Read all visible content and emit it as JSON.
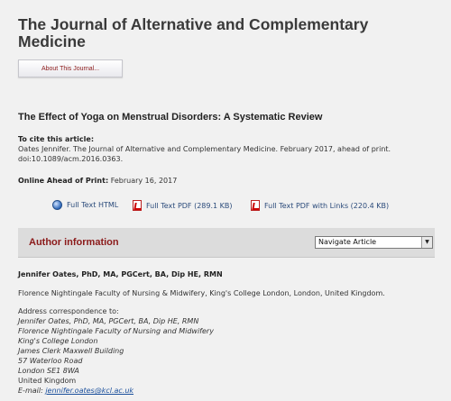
{
  "journal": {
    "title": "The Journal of Alternative and Complementary Medicine",
    "about_button": "About This Journal..."
  },
  "article": {
    "title": "The Effect of Yoga on Menstrual Disorders: A Systematic Review",
    "cite_label": "To cite this article:",
    "cite_text": "Oates Jennifer. The Journal of Alternative and Complementary Medicine. February 2017, ahead of print. doi:10.1089/acm.2016.0363.",
    "online_label": "Online Ahead of Print:",
    "online_date": "February 16, 2017"
  },
  "links": [
    {
      "label": "Full Text HTML",
      "icon": "html-globe-icon"
    },
    {
      "label": "Full Text PDF (289.1 KB)",
      "icon": "pdf-icon"
    },
    {
      "label": "Full Text PDF with Links (220.4 KB)",
      "icon": "pdf-icon"
    }
  ],
  "author_section": {
    "heading": "Author information",
    "navigate_select": "Navigate Article",
    "author_name": "Jennifer Oates, PhD, MA, PGCert, BA, Dip HE, RMN",
    "affiliation": "Florence Nightingale Faculty of Nursing & Midwifery, King's College London, London, United Kingdom.",
    "address_label": "Address correspondence to:",
    "address_lines": [
      "Jennifer Oates, PhD, MA, PGCert, BA, Dip HE, RMN",
      "Florence Nightingale Faculty of Nursing and Midwifery",
      "King's College London",
      "James Clerk Maxwell Building",
      "57 Waterloo Road",
      "London SE1 8WA"
    ],
    "country": "United Kingdom",
    "email_label": "E-mail:",
    "email": "jennifer.oates@kcl.ac.uk"
  }
}
